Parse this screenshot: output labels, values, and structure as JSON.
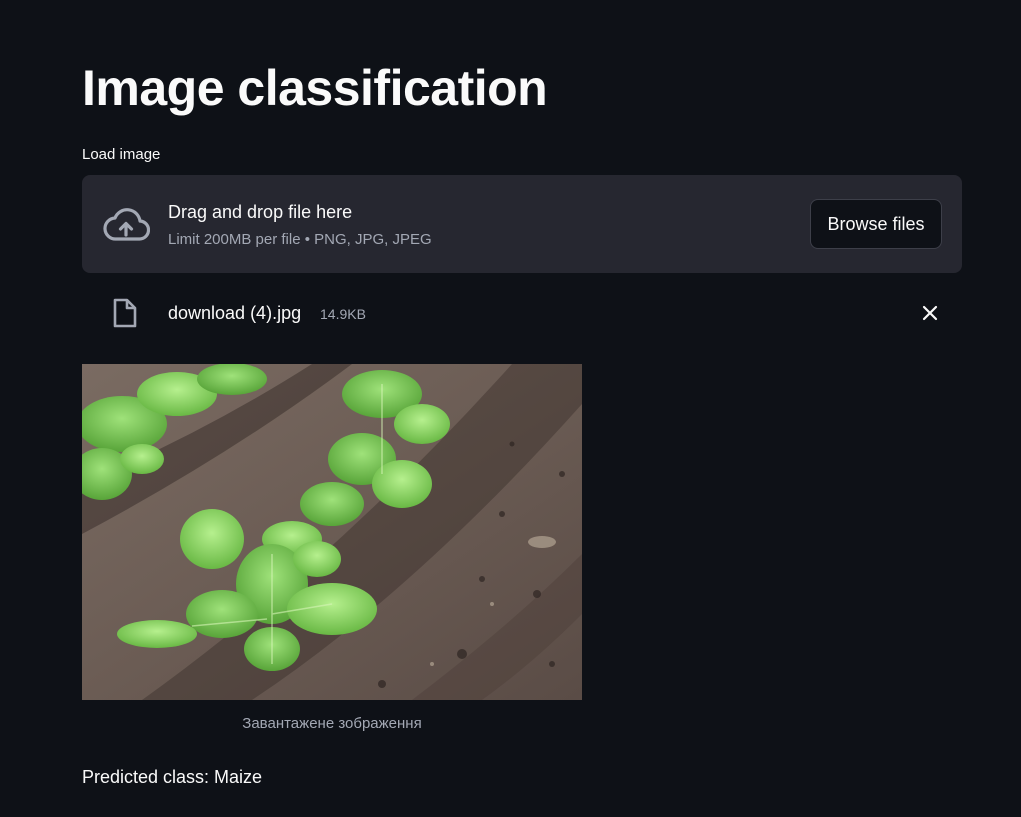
{
  "page": {
    "title": "Image classification"
  },
  "uploader": {
    "label": "Load image",
    "dropzone_main": "Drag and drop file here",
    "dropzone_sub": "Limit 200MB per file • PNG, JPG, JPEG",
    "browse_label": "Browse files",
    "icon": "cloud-upload-icon"
  },
  "uploaded_file": {
    "name": "download (4).jpg",
    "size": "14.9KB",
    "icon": "file-icon",
    "remove_icon": "close-icon"
  },
  "image": {
    "caption": "Завантажене зображення"
  },
  "result": {
    "text": "Predicted class: Maize"
  },
  "colors": {
    "background": "#0e1117",
    "dropzone": "#262730",
    "text": "#fafafa",
    "muted_text": "#a3a8b4"
  }
}
